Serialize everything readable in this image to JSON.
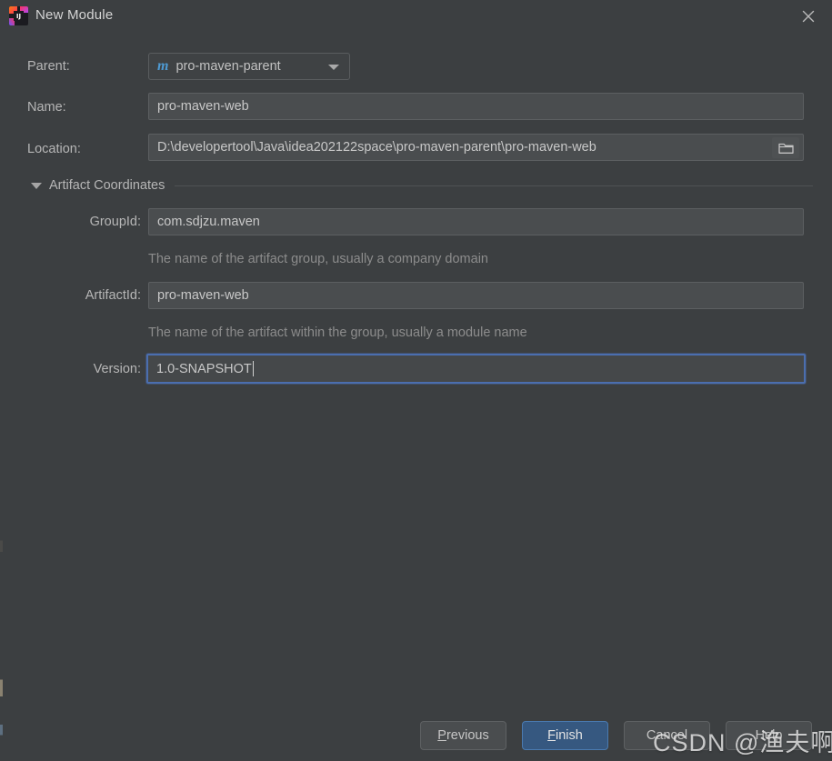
{
  "window": {
    "title": "New Module",
    "app_icon": "intellij-idea-logo",
    "close_icon": "close-icon"
  },
  "form": {
    "parent": {
      "label": "Parent:",
      "value": "pro-maven-parent",
      "icon": "maven-module-icon",
      "dropdown_icon": "chevron-down-icon"
    },
    "name": {
      "label": "Name:",
      "value": "pro-maven-web"
    },
    "location": {
      "label": "Location:",
      "value": "D:\\developertool\\Java\\idea202122space\\pro-maven-parent\\pro-maven-web",
      "browse_icon": "folder-icon"
    }
  },
  "artifact_coordinates": {
    "title": "Artifact Coordinates",
    "expanded": true,
    "collapse_icon": "triangle-down-icon",
    "group_id": {
      "label": "GroupId:",
      "value": "com.sdjzu.maven",
      "hint": "The name of the artifact group, usually a company domain"
    },
    "artifact_id": {
      "label": "ArtifactId:",
      "value": "pro-maven-web",
      "hint": "The name of the artifact within the group, usually a module name"
    },
    "version": {
      "label": "Version:",
      "value": "1.0-SNAPSHOT",
      "focused": true
    }
  },
  "buttons": {
    "previous": {
      "mnemonic": "P",
      "rest": "revious"
    },
    "finish": {
      "mnemonic": "F",
      "rest": "inish"
    },
    "cancel": {
      "label": "Cancel"
    },
    "help": {
      "label": "Help"
    }
  },
  "watermark": {
    "text": "CSDN @渔夫啊布"
  },
  "colors": {
    "dialog_background": "#3c3f41",
    "field_background": "#4a4d4f",
    "field_border": "#5c5f61",
    "focus_border": "#4b6eaf",
    "primary_button": "#365880",
    "text": "#b6b6b6",
    "hint_text": "#8c8c8c",
    "maven_icon": "#4e9bd4"
  }
}
